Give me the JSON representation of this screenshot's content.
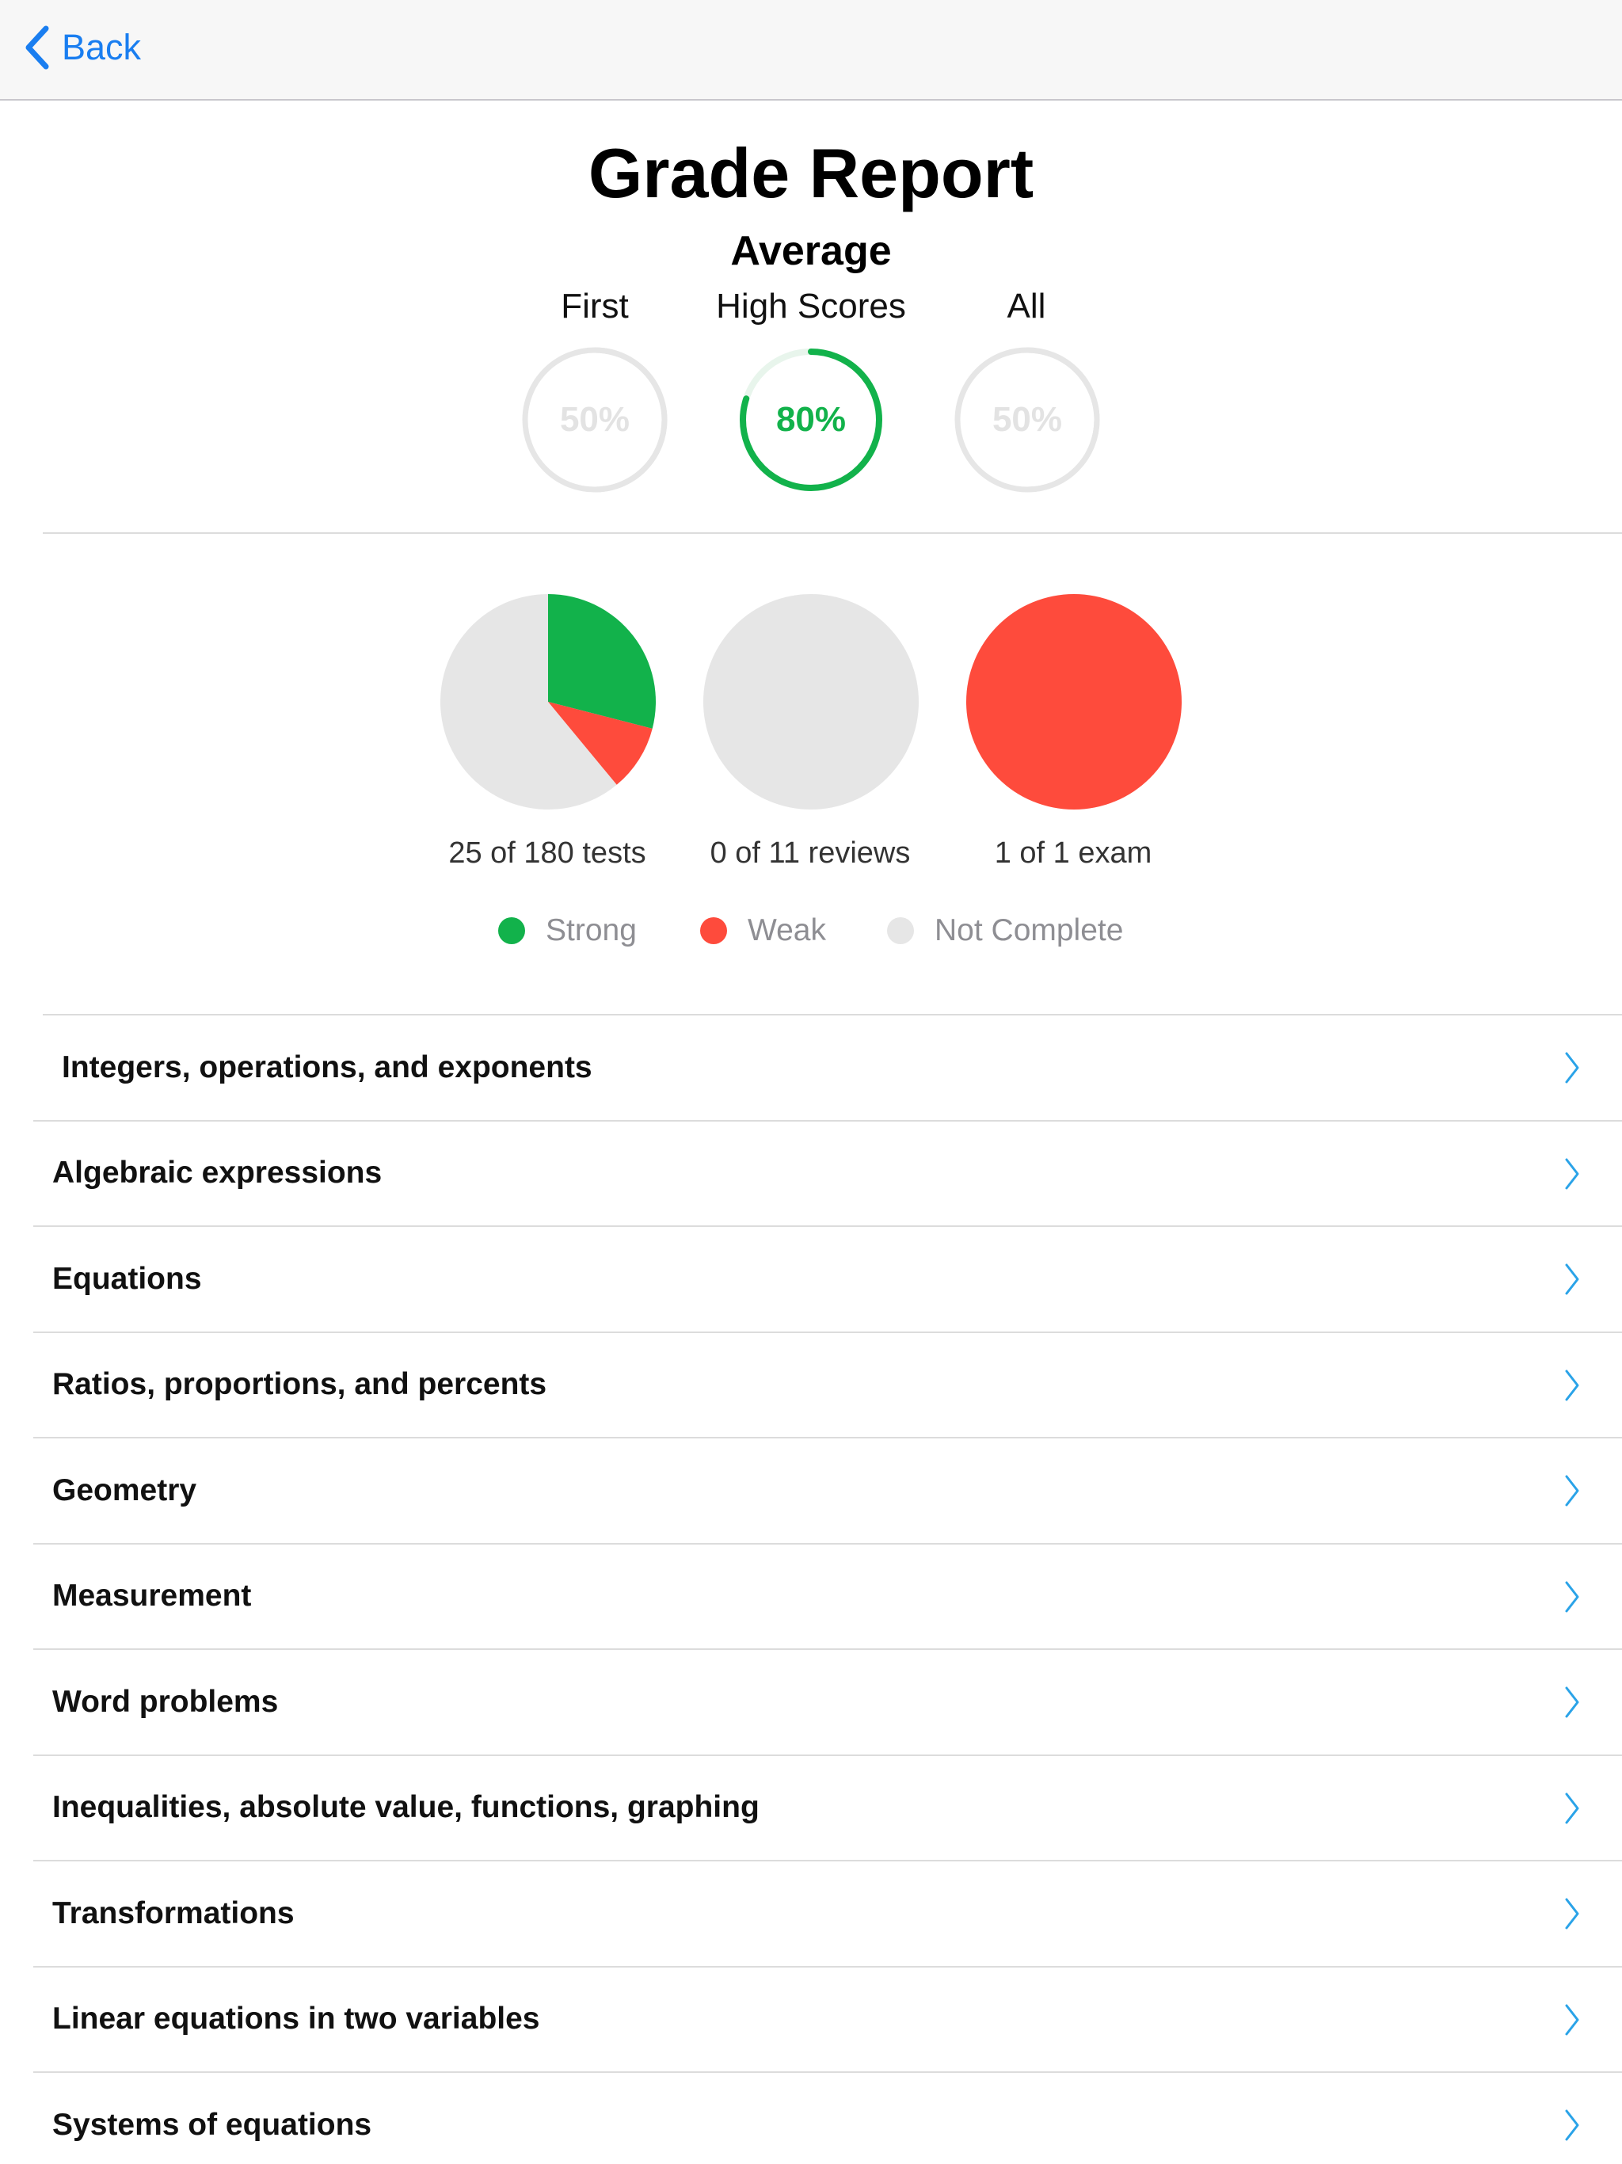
{
  "nav": {
    "back_label": "Back"
  },
  "header": {
    "title": "Grade Report",
    "subtitle": "Average"
  },
  "averages": [
    {
      "label": "First",
      "value": "50%",
      "percent": 50,
      "active": false
    },
    {
      "label": "High Scores",
      "value": "80%",
      "percent": 80,
      "active": true
    },
    {
      "label": "All",
      "value": "50%",
      "percent": 50,
      "active": false
    }
  ],
  "chart_data": {
    "type": "pie",
    "charts": [
      {
        "caption": "25 of 180 tests",
        "slices": [
          {
            "name": "Strong",
            "fraction": 0.29
          },
          {
            "name": "Weak",
            "fraction": 0.1
          },
          {
            "name": "Not Complete",
            "fraction": 0.61
          }
        ]
      },
      {
        "caption": "0 of 11 reviews",
        "slices": [
          {
            "name": "Strong",
            "fraction": 0
          },
          {
            "name": "Weak",
            "fraction": 0
          },
          {
            "name": "Not Complete",
            "fraction": 1
          }
        ]
      },
      {
        "caption": "1 of 1 exam",
        "slices": [
          {
            "name": "Strong",
            "fraction": 0
          },
          {
            "name": "Weak",
            "fraction": 1
          },
          {
            "name": "Not Complete",
            "fraction": 0
          }
        ]
      }
    ],
    "legend": [
      {
        "name": "Strong",
        "color": "#12b24b"
      },
      {
        "name": "Weak",
        "color": "#fe4b3c"
      },
      {
        "name": "Not Complete",
        "color": "#e6e6e6"
      }
    ]
  },
  "colors": {
    "accent": "#1a7ef0",
    "strong": "#12b24b",
    "weak": "#fe4b3c",
    "incomplete": "#e6e6e6",
    "chevron": "#2aa3e8"
  },
  "topics": [
    "Integers, operations, and exponents",
    "Algebraic expressions",
    "Equations",
    "Ratios, proportions, and percents",
    "Geometry",
    "Measurement",
    "Word problems",
    "Inequalities, absolute value, functions, graphing",
    "Transformations",
    "Linear equations in two variables",
    "Systems of equations"
  ]
}
